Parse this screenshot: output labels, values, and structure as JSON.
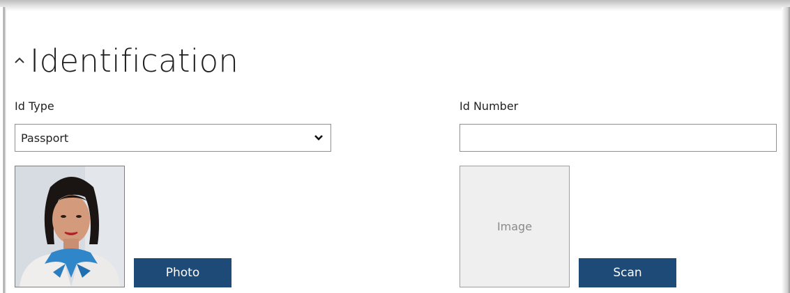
{
  "section": {
    "title": "Identification"
  },
  "id_type": {
    "label": "Id Type",
    "selected": "Passport"
  },
  "id_number": {
    "label": "Id Number",
    "value": "",
    "placeholder": ""
  },
  "photo": {
    "button_label": "Photo"
  },
  "scan": {
    "placeholder_text": "Image",
    "button_label": "Scan"
  },
  "colors": {
    "button": "#1e4a77",
    "placeholder_bg": "#efefef"
  },
  "icons": {
    "collapse": "chevron-up-icon",
    "dropdown": "chevron-down-icon"
  }
}
